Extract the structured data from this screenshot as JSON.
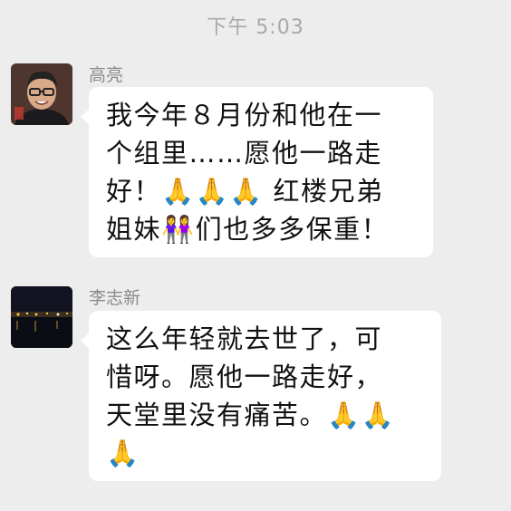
{
  "status": {
    "time": "下午 5:03"
  },
  "messages": [
    {
      "sender": "高亮",
      "avatar": "avatar-man-glasses",
      "lines": [
        "我今年８月份和他在一",
        "个组里……愿他一路走",
        "好！🙏🙏🙏 红楼兄弟",
        "姐妹👭们也多多保重！"
      ]
    },
    {
      "sender": "李志新",
      "avatar": "avatar-night-city",
      "lines": [
        "这么年轻就去世了，可",
        "惜呀。愿他一路走好，",
        "天堂里没有痛苦。🙏🙏",
        "🙏"
      ]
    }
  ],
  "colors": {
    "background": "#ededed",
    "bubble": "#ffffff",
    "timestamp": "#a8a8a8",
    "sender": "#8a8a8a",
    "text": "#111111"
  }
}
